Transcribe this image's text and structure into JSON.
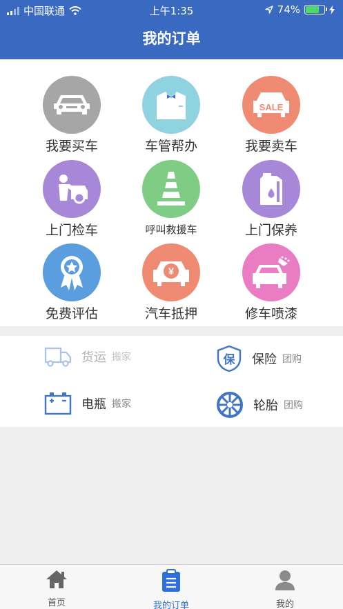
{
  "status_bar": {
    "carrier": "中国联通",
    "time": "上午1:35",
    "battery": "74%",
    "battery_level": 0.74
  },
  "header": {
    "title": "我的订单"
  },
  "services": [
    {
      "label": "我要买车",
      "icon": "car-icon",
      "color": "#a6a6a6"
    },
    {
      "label": "车管帮办",
      "icon": "suit-icon",
      "color": "#8fd3e0"
    },
    {
      "label": "我要卖车",
      "icon": "sale-car-icon",
      "color": "#f08b73"
    },
    {
      "label": "上门检车",
      "icon": "mechanic-icon",
      "color": "#a788d8"
    },
    {
      "label": "呼叫救援车",
      "icon": "traffic-cone-icon",
      "color": "#7fcd85"
    },
    {
      "label": "上门保养",
      "icon": "oil-can-icon",
      "color": "#a788d8"
    },
    {
      "label": "免费评估",
      "icon": "badge-icon",
      "color": "#5a9ee0"
    },
    {
      "label": "汽车抵押",
      "icon": "yen-car-icon",
      "color": "#f08b73"
    },
    {
      "label": "修车喷漆",
      "icon": "spray-car-icon",
      "color": "#e97cc2"
    }
  ],
  "quick_list": [
    {
      "title": "货运",
      "sub": "搬家",
      "icon": "truck-icon",
      "dim": true
    },
    {
      "title": "保险",
      "sub": "团购",
      "icon": "insurance-icon",
      "icon_char": "保",
      "dim": false
    },
    {
      "title": "电瓶",
      "sub": "搬家",
      "icon": "battery-icon",
      "dim": false
    },
    {
      "title": "轮胎",
      "sub": "团购",
      "icon": "tire-icon",
      "dim": false
    }
  ],
  "tabs": [
    {
      "label": "首页",
      "icon": "home-icon"
    },
    {
      "label": "我的订单",
      "icon": "orders-icon",
      "active": true
    },
    {
      "label": "我的",
      "icon": "user-icon"
    }
  ],
  "colors": {
    "brand": "#3a69c1",
    "icon_blue": "#3f74c6",
    "active_tab": "#2f6fd9"
  }
}
